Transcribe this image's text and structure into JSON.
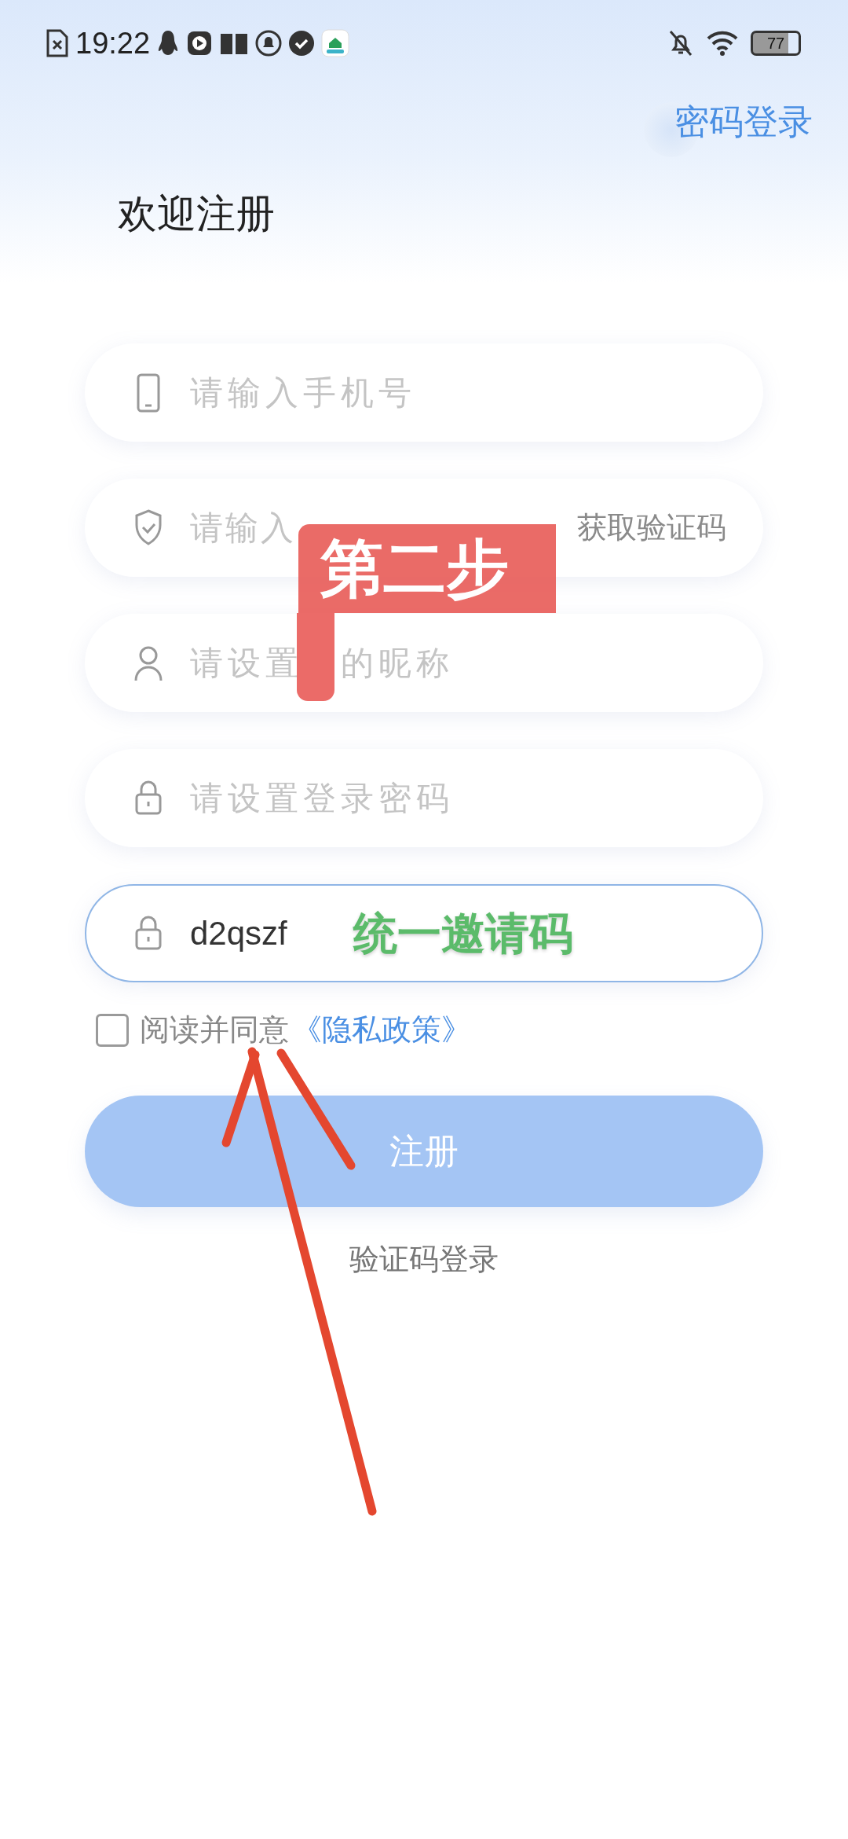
{
  "status_bar": {
    "time": "19:22",
    "battery": "77"
  },
  "header": {
    "switch_link": "密码登录",
    "title": "欢迎注册"
  },
  "fields": [
    {
      "kind": "phone",
      "placeholder": "请输入手机号"
    },
    {
      "kind": "sms",
      "placeholder": "请输入",
      "action": "获取验证码"
    },
    {
      "kind": "nickname",
      "placeholder": "请设置　的昵称"
    },
    {
      "kind": "password",
      "placeholder": "请设置登录密码"
    },
    {
      "kind": "invite",
      "value": "d2qszf",
      "focused": true
    }
  ],
  "agreement": {
    "checked": false,
    "text": "阅读并同意",
    "link": "《隐私政策》"
  },
  "register_button": "注册",
  "alt_login": "验证码登录",
  "annotations": [
    {
      "kind": "flag",
      "text": "第二步"
    },
    {
      "kind": "note",
      "text": "统一邀请码"
    },
    {
      "kind": "arrow"
    }
  ]
}
